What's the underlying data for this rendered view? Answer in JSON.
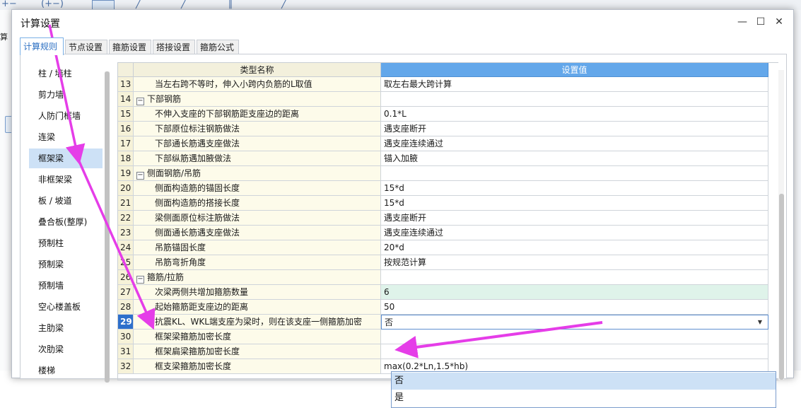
{
  "background": {
    "side_text": "算",
    "toolbar_icons": [
      "+−",
      "(+−)",
      "pen-icon",
      "pen-icon",
      "bars-icon",
      "pen-icon"
    ]
  },
  "dialog": {
    "title": "计算设置",
    "window_buttons": {
      "minimize": "—",
      "maximize": "☐",
      "close": "✕"
    }
  },
  "tabs": [
    {
      "label": "计算规则",
      "active": true
    },
    {
      "label": "节点设置",
      "active": false
    },
    {
      "label": "箍筋设置",
      "active": false
    },
    {
      "label": "搭接设置",
      "active": false
    },
    {
      "label": "箍筋公式",
      "active": false
    }
  ],
  "left_list": {
    "selected_index": 4,
    "items": [
      "柱 / 墙柱",
      "剪力墙",
      "人防门框墙",
      "连梁",
      "框架梁",
      "非框架梁",
      "板 / 坡道",
      "叠合板(整厚)",
      "预制柱",
      "预制梁",
      "预制墙",
      "空心楼盖板",
      "主肋梁",
      "次肋梁",
      "楼梯"
    ]
  },
  "grid": {
    "header": {
      "name": "类型名称",
      "value": "设置值"
    },
    "rows": [
      {
        "num": "13",
        "type": "item",
        "name": "当左右跨不等时，伸入小跨内负筋的L取值",
        "value": "取左右最大跨计算"
      },
      {
        "num": "14",
        "type": "group",
        "toggle": "−",
        "name": "下部钢筋",
        "value": ""
      },
      {
        "num": "15",
        "type": "item",
        "name": "不伸入支座的下部钢筋距支座边的距离",
        "value": "0.1*L"
      },
      {
        "num": "16",
        "type": "item",
        "name": "下部原位标注钢筋做法",
        "value": "遇支座断开"
      },
      {
        "num": "17",
        "type": "item",
        "name": "下部通长筋遇支座做法",
        "value": "遇支座连续通过"
      },
      {
        "num": "18",
        "type": "item",
        "name": "下部纵筋遇加腋做法",
        "value": "锚入加腋"
      },
      {
        "num": "19",
        "type": "group",
        "toggle": "−",
        "name": "侧面钢筋/吊筋",
        "value": ""
      },
      {
        "num": "20",
        "type": "item",
        "name": "侧面构造筋的锚固长度",
        "value": "15*d"
      },
      {
        "num": "21",
        "type": "item",
        "name": "侧面构造筋的搭接长度",
        "value": "15*d"
      },
      {
        "num": "22",
        "type": "item",
        "name": "梁侧面原位标注筋做法",
        "value": "遇支座断开"
      },
      {
        "num": "23",
        "type": "item",
        "name": "侧面通长筋遇支座做法",
        "value": "遇支座连续通过"
      },
      {
        "num": "24",
        "type": "item",
        "name": "吊筋锚固长度",
        "value": "20*d"
      },
      {
        "num": "25",
        "type": "item",
        "name": "吊筋弯折角度",
        "value": "按规范计算"
      },
      {
        "num": "26",
        "type": "group",
        "toggle": "−",
        "name": "箍筋/拉筋",
        "value": ""
      },
      {
        "num": "27",
        "type": "item",
        "name": "次梁两侧共增加箍筋数量",
        "value": "6"
      },
      {
        "num": "28",
        "type": "item",
        "name": "起始箍筋距支座边的距离",
        "value": "50"
      },
      {
        "num": "29",
        "type": "item",
        "name": "抗震KL、WKL端支座为梁时，则在该支座一侧箍筋加密",
        "value": "否",
        "selected": true,
        "editing": true
      },
      {
        "num": "30",
        "type": "item",
        "name": "框架梁箍筋加密长度",
        "value": ""
      },
      {
        "num": "31",
        "type": "item",
        "name": "框架扁梁箍筋加密长度",
        "value": ""
      },
      {
        "num": "32",
        "type": "item",
        "name": "框支梁箍筋加密长度",
        "value": "max(0.2*Ln,1.5*hb)"
      }
    ]
  },
  "dropdown": {
    "options": [
      {
        "label": "否",
        "hovered": true
      },
      {
        "label": "是",
        "hovered": false
      }
    ]
  },
  "annotation": {
    "color": "#e53de8"
  }
}
